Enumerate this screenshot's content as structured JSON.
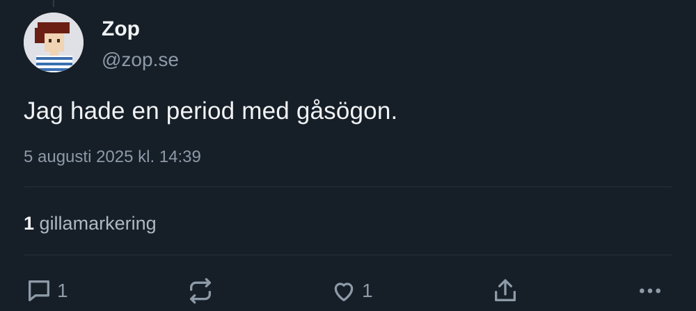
{
  "author": {
    "display_name": "Zop",
    "handle": "@zop.se",
    "avatar_icon": "pixel-art-avatar"
  },
  "post": {
    "text": "Jag hade en period med gåsögon.",
    "timestamp": "5 augusti 2025 kl. 14:39"
  },
  "likes": {
    "count": "1",
    "label": "gillamarkering"
  },
  "actions": {
    "reply": {
      "icon": "reply-icon",
      "count": "1"
    },
    "repost": {
      "icon": "repost-icon",
      "count": ""
    },
    "like": {
      "icon": "heart-icon",
      "count": "1"
    },
    "share": {
      "icon": "share-icon"
    },
    "more": {
      "icon": "more-icon"
    }
  },
  "colors": {
    "background": "#161e27",
    "text_primary": "#f1f3f5",
    "text_secondary": "#8d9aa8",
    "divider": "#26313c"
  }
}
